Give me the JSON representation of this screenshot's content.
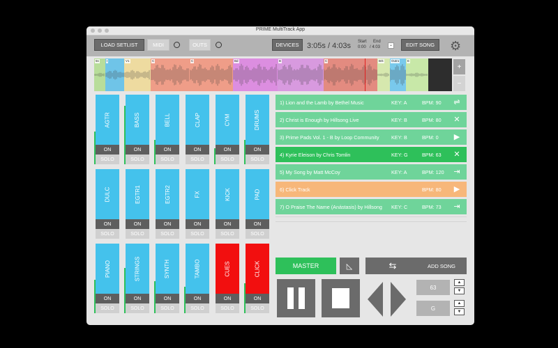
{
  "window": {
    "title": "PRIME MultiTrack App"
  },
  "toolbar": {
    "load_setlist": "LOAD SETLIST",
    "midi": "MIDI",
    "outs": "OUTS",
    "devices": "DEVICES",
    "time": "3:05s / 4:03s",
    "start_label": "Start",
    "start_value": "0:00",
    "end_label": "End",
    "end_value": "/ 4:03",
    "dropdown": "⌄",
    "edit_song": "EDIT SONG"
  },
  "waveform": {
    "sections": [
      {
        "label": "5s",
        "color": "#b8dd9a"
      },
      {
        "label": "I",
        "color": "#6fc4e8"
      },
      {
        "label": "V1",
        "color": "#eedba0"
      },
      {
        "label": "C",
        "color": "#ef9d88"
      },
      {
        "label": "C",
        "color": "#ef9d88"
      },
      {
        "label": "Bd",
        "color": "#dc8ee0"
      },
      {
        "label": "B",
        "color": "#d89adf"
      },
      {
        "label": "C",
        "color": "#e38b80"
      },
      {
        "label": "Brk",
        "color": "#d6e8ae"
      },
      {
        "label": "Outro",
        "color": "#79c9ec"
      },
      {
        "label": "E",
        "color": "#c8e8a8"
      }
    ],
    "zoom_in": "+",
    "zoom_out": "−"
  },
  "tracks": [
    {
      "name": "AGTR",
      "color": "#44c2ec",
      "on": "ON",
      "solo": "SOLO",
      "level": 0.47
    },
    {
      "name": "BASS",
      "color": "#44c2ec",
      "on": "ON",
      "solo": "SOLO",
      "level": 0.84
    },
    {
      "name": "BELL",
      "color": "#44c2ec",
      "on": "ON",
      "solo": "SOLO",
      "level": 0.35
    },
    {
      "name": "CLAP",
      "color": "#44c2ec",
      "on": "ON",
      "solo": "SOLO",
      "level": 0.0
    },
    {
      "name": "CYM",
      "color": "#44c2ec",
      "on": "ON",
      "solo": "SOLO",
      "level": 0.23
    },
    {
      "name": "DRUMS",
      "color": "#44c2ec",
      "on": "ON",
      "solo": "SOLO",
      "level": 0.35
    },
    {
      "name": "DULC",
      "color": "#44c2ec",
      "on": "ON",
      "solo": "SOLO",
      "level": 0.0
    },
    {
      "name": "EGTR1",
      "color": "#44c2ec",
      "on": "ON",
      "solo": "SOLO",
      "level": 0.0
    },
    {
      "name": "EGTR2",
      "color": "#44c2ec",
      "on": "ON",
      "solo": "SOLO",
      "level": 0.0
    },
    {
      "name": "FX",
      "color": "#44c2ec",
      "on": "ON",
      "solo": "SOLO",
      "level": 0.0
    },
    {
      "name": "KICK",
      "color": "#44c2ec",
      "on": "ON",
      "solo": "SOLO",
      "level": 0.0
    },
    {
      "name": "PAD",
      "color": "#44c2ec",
      "on": "ON",
      "solo": "SOLO",
      "level": 0.0
    },
    {
      "name": "PIANO",
      "color": "#44c2ec",
      "on": "ON",
      "solo": "SOLO",
      "level": 0.48
    },
    {
      "name": "STRINGS",
      "color": "#44c2ec",
      "on": "ON",
      "solo": "SOLO",
      "level": 0.65
    },
    {
      "name": "SYNTH",
      "color": "#44c2ec",
      "on": "ON",
      "solo": "SOLO",
      "level": 0.46
    },
    {
      "name": "TAMBO",
      "color": "#44c2ec",
      "on": "ON",
      "solo": "SOLO",
      "level": 0.38
    },
    {
      "name": "CUES",
      "color": "#f20f0f",
      "on": "ON",
      "solo": "SOLO",
      "level": 0.0
    },
    {
      "name": "CLICK",
      "color": "#f20f0f",
      "on": "ON",
      "solo": "SOLO",
      "level": 0.43
    }
  ],
  "songs": [
    {
      "title": "1) Lion and the Lamb by Bethel Music",
      "key": "KEY: A",
      "bpm": "BPM: 90",
      "action": "reorder-icon",
      "action_glyph": "⇌",
      "color": "#6fd49a"
    },
    {
      "title": "2) Christ is Enough by Hillsong Live",
      "key": "KEY: B",
      "bpm": "BPM: 80",
      "action": "remove-icon",
      "action_glyph": "✕",
      "color": "#6fd49a"
    },
    {
      "title": "3) Prime Pads Vol. 1 - B by Loop Community",
      "key": "KEY: B",
      "bpm": "BPM: 0",
      "action": "play-icon",
      "action_glyph": "▶",
      "color": "#6fd49a"
    },
    {
      "title": "4) Kyrie Eleison by Chris Tomlin",
      "key": "KEY: G",
      "bpm": "BPM: 63",
      "action": "remove-icon",
      "action_glyph": "✕",
      "color": "#2ec05a"
    },
    {
      "title": "5) My Song by Matt McCoy",
      "key": "KEY: A",
      "bpm": "BPM: 120",
      "action": "exit-icon",
      "action_glyph": "⇥",
      "color": "#6fd49a"
    },
    {
      "title": "6) Click Track",
      "key": "",
      "bpm": "BPM: 80",
      "action": "play-icon",
      "action_glyph": "▶",
      "color": "#f7b77a"
    },
    {
      "title": "7) O Praise The Name (Anástasis) by Hillsong",
      "key": "KEY: C",
      "bpm": "BPM: 73",
      "action": "exit-icon",
      "action_glyph": "⇥",
      "color": "#6fd49a"
    }
  ],
  "controls": {
    "master": "MASTER",
    "add_song": "ADD SONG",
    "bpm_value": "63",
    "key_value": "G",
    "up": "▲",
    "down": "▼"
  }
}
